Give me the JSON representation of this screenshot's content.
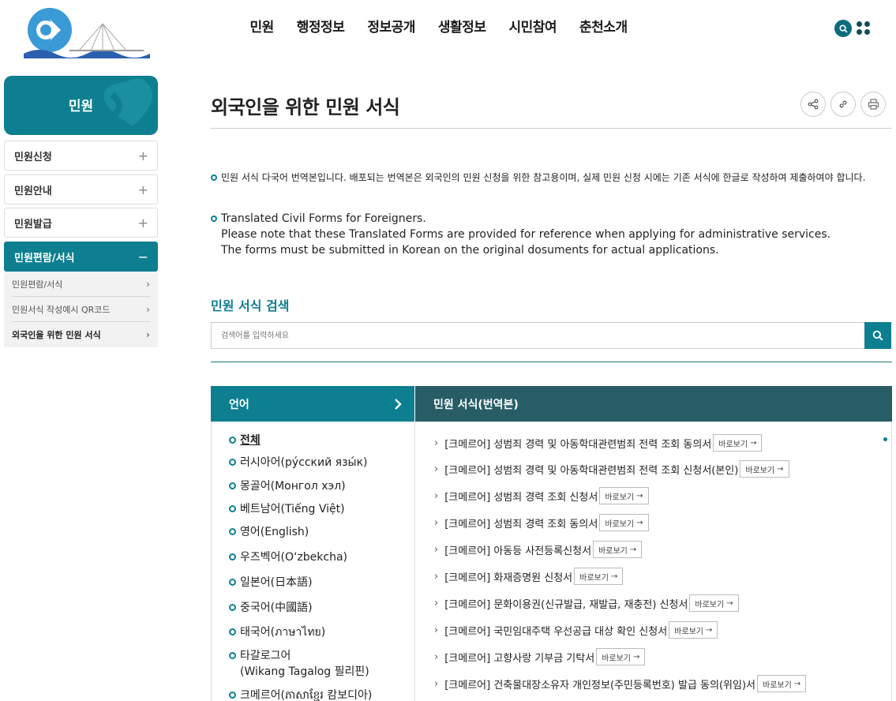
{
  "header": {
    "nav": [
      "민원",
      "행정정보",
      "정보공개",
      "생활정보",
      "시민참여",
      "춘천소개"
    ]
  },
  "sidebar": {
    "title": "민원",
    "items": [
      {
        "label": "민원신청",
        "toggle": "+"
      },
      {
        "label": "민원안내",
        "toggle": "+"
      },
      {
        "label": "민원발급",
        "toggle": "+"
      },
      {
        "label": "민원편람/서식",
        "toggle": "−"
      }
    ],
    "sub_items": [
      "민원편람/서식",
      "민원서식 작성예시 QR코드",
      "외국인을 위한 민원 서식"
    ]
  },
  "main": {
    "page_title": "외국인을 위한 민원 서식",
    "notice_ko": "민원 서식 다국어 번역본입니다. 배포되는 번역본은 외국인의 민원 신청을 위한 참고용이며, 실제 민원 신청 시에는 기존 서식에 한글로 작성하여 제출하여야 합니다.",
    "notice_en_1": "Translated Civil Forms for Foreigners.",
    "notice_en_2": "Please note that these Translated Forms are provided for reference when applying for administrative services.",
    "notice_en_3": "The forms must be submitted in Korean on the original dosuments for actual applications.",
    "search_title": "민원 서식 검색",
    "search_placeholder": "검색어를 입력하세요",
    "lang_header": "언어",
    "forms_header": "민원 서식(번역본)",
    "languages": [
      "전체",
      "러시아어(ру́сский язы́к)",
      "몽골어(Монгол хэл)",
      "베트남어(Tiếng Việt)",
      "영어(English)",
      "우즈벡어(O‘zbekcha)",
      "일본어(日本語)",
      "중국어(中國語)",
      "태국어(ภาษาไทย)",
      "타갈로그어",
      "(Wikang Tagalog 필리핀)",
      "크메르어(ភាសាខ្មែរ 캄보디아)"
    ],
    "view_label": "바로보기",
    "forms": [
      "[크메르어]  성범죄 경력 및 아동학대관련범죄 전력 조회 동의서",
      "[크메르어]  성범죄 경력 및 아동학대관련범죄 전력 조회 신청서(본인)",
      "[크메르어]  성범죄 경력 조회 신청서",
      "[크메르어]  성범죄 경력 조회 동의서",
      "[크메르어]  아동등 사전등록신청서",
      "[크메르어]  화재증명원 신청서",
      "[크메르어]  문화이용권(신규발급, 재발급, 재충전) 신청서",
      "[크메르어]  국민임대주택 우선공급 대상 확인 신청서",
      "[크메르어]  고향사랑 기부금 기탁서",
      "[크메르어]  건축물대장소유자 개인정보(주민등록번호) 발급 동의(위임)서"
    ]
  },
  "colors": {
    "accent": "#0d7f90",
    "accent_dark": "#285d66"
  }
}
